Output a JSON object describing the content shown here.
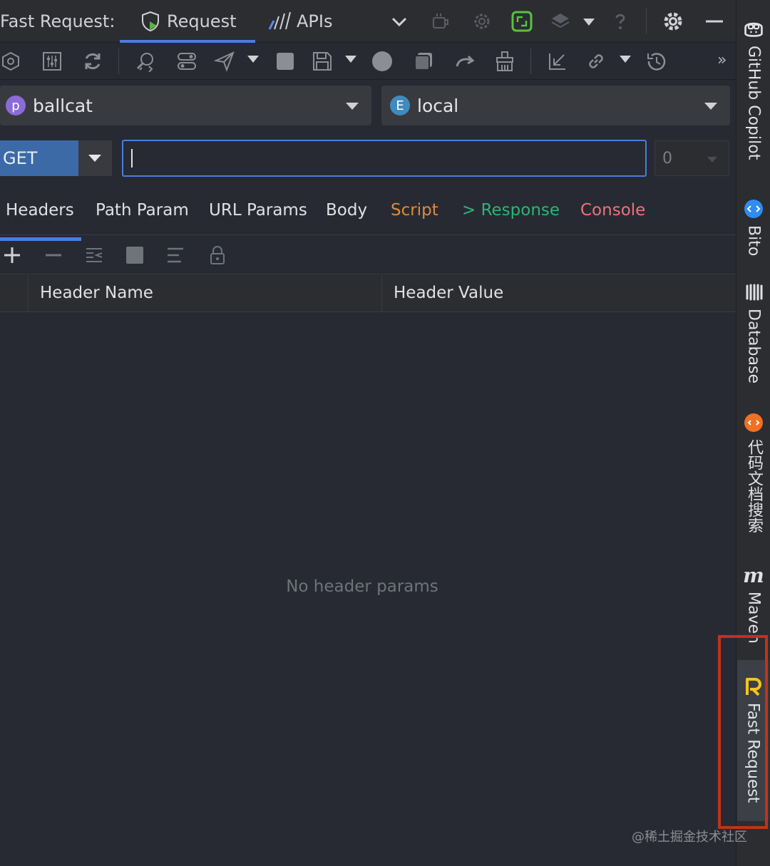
{
  "titlebar": {
    "app_title": "Fast Request:",
    "tabs": [
      {
        "label": "Request",
        "active": true,
        "icon": "request-shield-play-icon"
      },
      {
        "label": "APIs",
        "active": false,
        "icon": "apis-chart-icon"
      }
    ],
    "icons": [
      "chevron-down-icon",
      "coffee-icon",
      "settings-gear-outline-icon",
      "resize-icon",
      "layers-icon",
      "chevron-down-icon",
      "help-icon",
      "gear-icon",
      "minimize-icon"
    ]
  },
  "toolbar": {
    "icons": [
      "hexagon-icon",
      "sliders-icon",
      "refresh-icon",
      "search-code-icon",
      "toggle-icon",
      "send-icon",
      "dropdown-caret",
      "stop-icon",
      "save-icon",
      "dropdown-caret",
      "record-icon",
      "copy-icon",
      "redo-icon",
      "clean-icon",
      "import-icon",
      "link-icon",
      "dropdown-caret",
      "history-icon"
    ],
    "overflow": "»"
  },
  "project_selector": {
    "badge": "p",
    "value": "ballcat",
    "badge_color": "#8c6bd6"
  },
  "env_selector": {
    "badge": "E",
    "value": "local",
    "badge_color": "#3f8bbf"
  },
  "request": {
    "method": "GET",
    "url_value": "",
    "count": "0"
  },
  "param_tabs": [
    {
      "label": "Headers",
      "active": true,
      "color": "#dfe1e5"
    },
    {
      "label": "Path Param",
      "active": false,
      "color": "#dfe1e5"
    },
    {
      "label": "URL Params",
      "active": false,
      "color": "#dfe1e5"
    },
    {
      "label": "Body",
      "active": false,
      "color": "#dfe1e5"
    },
    {
      "label": "Script",
      "active": false,
      "color": "#e08a3a"
    },
    {
      "label": "> Response",
      "active": false,
      "color": "#2bb673"
    },
    {
      "label": "Console",
      "active": false,
      "color": "#f07178"
    }
  ],
  "table": {
    "columns": [
      "Header Name",
      "Header Value"
    ],
    "empty_text": "No header params"
  },
  "sidebar": {
    "items": [
      {
        "label": "GitHub Copilot",
        "icon": "copilot-icon"
      },
      {
        "label": "Bito",
        "icon": "bito-icon"
      },
      {
        "label": "Database",
        "icon": "database-icon"
      },
      {
        "label": "代码文档搜索",
        "icon": "code-search-icon"
      },
      {
        "label": "Maven",
        "icon": "maven-icon"
      },
      {
        "label": "Fast Request",
        "icon": "fast-request-icon",
        "active": true
      }
    ]
  },
  "watermark": "@稀土掘金技术社区"
}
